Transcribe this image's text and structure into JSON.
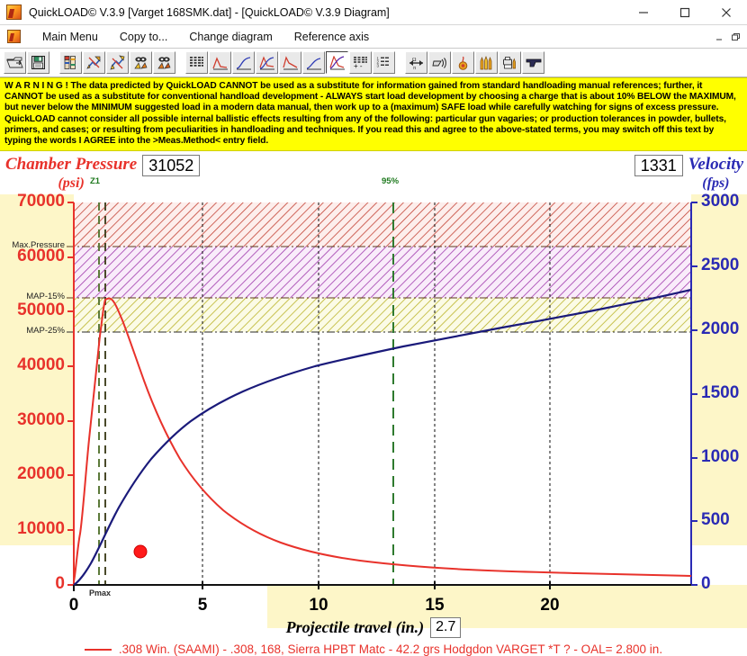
{
  "window": {
    "title": "QuickLOAD© V.3.9   [Varget 168SMK.dat] - [QuickLOAD© V.3.9 Diagram]",
    "minimize_label": "–",
    "maximize_label": "□",
    "close_label": "✕",
    "mdi_restore_label": "–",
    "mdi_max_label": "❐"
  },
  "menu": {
    "items": [
      {
        "label": "Main Menu"
      },
      {
        "label": "Copy to..."
      },
      {
        "label": "Change diagram"
      },
      {
        "label": "Reference axis"
      }
    ]
  },
  "toolbar": {
    "buttons": [
      {
        "name": "open-file-icon",
        "pressed": false
      },
      {
        "name": "save-file-icon",
        "pressed": false
      },
      {
        "name": "cartridge-data-icon",
        "pressed": false
      },
      {
        "name": "powder-blue-icon",
        "pressed": false
      },
      {
        "name": "powder-yellow-icon",
        "pressed": false
      },
      {
        "name": "bullet-yellow-icon",
        "pressed": false
      },
      {
        "name": "bullet-orange-icon",
        "pressed": false
      },
      {
        "name": "table-grid-icon",
        "pressed": false
      },
      {
        "name": "pressure-peak-curve-icon",
        "pressed": false
      },
      {
        "name": "velocity-curve-icon",
        "pressed": false
      },
      {
        "name": "pressure-velocity-curve-icon",
        "pressed": false
      },
      {
        "name": "pressure-decay-curve-icon",
        "pressed": false
      },
      {
        "name": "blue-rise-curve-icon",
        "pressed": false
      },
      {
        "name": "combined-diagram-icon",
        "pressed": true
      },
      {
        "name": "table-plusminus-icon",
        "pressed": false
      },
      {
        "name": "numbered-list-icon",
        "pressed": false
      },
      {
        "name": "balance-units-icon",
        "pressed": false
      },
      {
        "name": "sound-speed-icon",
        "pressed": false
      },
      {
        "name": "powder-burn-icon",
        "pressed": false
      },
      {
        "name": "cartridge-compare-icon",
        "pressed": false
      },
      {
        "name": "case-print-icon",
        "pressed": false
      },
      {
        "name": "firearm-icon",
        "pressed": false
      }
    ]
  },
  "warning": {
    "text": "W A R N I N G ! The data predicted by QuickLOAD CANNOT be used as a substitute for information gained from standard handloading manual references; further, it CANNOT be used as a substitute for conventional handload development - ALWAYS start load development by choosing a charge that is about 10% BELOW the MAXIMUM, but never below the MINIMUM suggested load in a modern data manual, then work up to a (maximum) SAFE load while carefully watching for signs of excess pressure. QuickLOAD cannot consider all possible internal ballistic effects resulting from any of the following: particular gun vagaries; or production tolerances in powder, bullets, primers, and cases; or resulting from peculiarities in handloading and techniques. If you read this and agree to the above-stated terms, you may switch off this text by typing the words I AGREE into the >Meas.Method< entry field."
  },
  "readouts": {
    "pressure_title": "Chamber Pressure",
    "pressure_unit": "(psi)",
    "pressure_value": "31052",
    "velocity_title": "Velocity",
    "velocity_unit": "(fps)",
    "velocity_value": "1331",
    "travel_title": "Projectile travel (in.)",
    "travel_value": "2.7"
  },
  "legend": {
    "text": ".308 Win. (SAAMI) - .308, 168, Sierra HPBT Matc - 42.2 grs Hodgdon VARGET *T ? - OAL= 2.800 in.",
    "line_color": "#e8322b"
  },
  "colors": {
    "pressure": "#e8322b",
    "velocity": "#1a1a7a",
    "marker_green": "#1f7a1f",
    "band_red": "#c0392b",
    "band_purple": "#9b30a8",
    "band_yellow": "#b8b020",
    "warning_bg": "#ffff00",
    "tint_bg": "#fdf6c8"
  },
  "chart_data": {
    "type": "line",
    "title": "Chamber Pressure & Velocity vs. Projectile travel",
    "xlabel": "Projectile travel (in.)",
    "ylabel": "Chamber Pressure (psi)",
    "y2label": "Velocity (fps)",
    "xlim": [
      0,
      24
    ],
    "ylim": [
      0,
      70000
    ],
    "y2lim": [
      0,
      3000
    ],
    "grid": true,
    "legend_position": "bottom",
    "xticks": [
      0,
      5,
      10,
      15,
      20
    ],
    "xtick_labels": [
      "0",
      "5",
      "10",
      "15",
      "20"
    ],
    "yticks": [
      0,
      10000,
      20000,
      30000,
      40000,
      50000,
      60000,
      70000
    ],
    "ytick_labels": [
      "0",
      "10000",
      "20000",
      "30000",
      "40000",
      "50000",
      "60000",
      "70000"
    ],
    "y2ticks": [
      0,
      500,
      1000,
      1500,
      2000,
      2500,
      3000
    ],
    "y2tick_labels": [
      "0",
      "500",
      "1000",
      "1500",
      "2000",
      "2500",
      "3000"
    ],
    "hlines": [
      {
        "label": "Max.Pressure",
        "value": 62000,
        "axis": "pressure"
      },
      {
        "label": "MAP-15%",
        "value": 52700,
        "axis": "pressure"
      },
      {
        "label": "MAP-25%",
        "value": 46500,
        "axis": "pressure"
      }
    ],
    "bands": [
      {
        "name": "over-max",
        "from": 62000,
        "to": 70000,
        "color": "#c0392b",
        "hatch": "///"
      },
      {
        "name": "map-to-max",
        "from": 52700,
        "to": 62000,
        "color": "#9b30a8",
        "hatch": "///"
      },
      {
        "name": "map-15-to-25",
        "from": 46500,
        "to": 52700,
        "color": "#b8b020",
        "hatch": "///"
      }
    ],
    "vlines": [
      {
        "label": "Z1",
        "x": 0.9,
        "color": "#1f7a1f",
        "style": "dashed"
      },
      {
        "label": "Pmax",
        "x": 1.15,
        "color": "#4a4a2a",
        "style": "dashed"
      },
      {
        "label": "95%",
        "x": 12.8,
        "color": "#1f7a1f",
        "style": "dashed"
      }
    ],
    "marker_point": {
      "x": 2.7,
      "y": 1331,
      "axis": "velocity",
      "color": "#e8322b"
    },
    "series": [
      {
        "name": "Chamber Pressure",
        "axis": "pressure",
        "color": "#e8322b",
        "x": [
          0.0,
          0.08,
          0.18,
          0.3,
          0.45,
          0.6,
          0.75,
          0.9,
          1.05,
          1.15,
          1.3,
          1.5,
          1.8,
          2.1,
          2.4,
          2.7,
          3.1,
          3.6,
          4.2,
          5.0,
          6.0,
          7.0,
          8.0,
          9.5,
          11.0,
          13.0,
          15.0,
          17.0,
          19.0,
          21.0,
          22.5,
          24.0
        ],
        "y": [
          600,
          3000,
          9500,
          20000,
          33000,
          42500,
          48800,
          51500,
          52200,
          52300,
          51500,
          49300,
          45000,
          40800,
          36800,
          33200,
          29200,
          25000,
          21300,
          17700,
          14800,
          12900,
          11600,
          10200,
          9200,
          8200,
          7400,
          6700,
          6200,
          5800,
          5500,
          5200
        ]
      },
      {
        "name": "Velocity",
        "axis": "velocity",
        "color": "#1a1a7a",
        "x": [
          0.0,
          0.1,
          0.25,
          0.45,
          0.7,
          1.0,
          1.4,
          1.9,
          2.4,
          2.7,
          3.2,
          3.8,
          4.5,
          5.2,
          6.0,
          7.0,
          8.0,
          9.5,
          11.0,
          13.0,
          15.0,
          17.0,
          19.0,
          21.0,
          22.5,
          24.0
        ],
        "y": [
          0,
          40,
          130,
          280,
          470,
          690,
          940,
          1180,
          1290,
          1331,
          1440,
          1545,
          1645,
          1730,
          1810,
          1900,
          1975,
          2070,
          2150,
          2250,
          2335,
          2410,
          2480,
          2545,
          2590,
          2630
        ]
      }
    ]
  }
}
